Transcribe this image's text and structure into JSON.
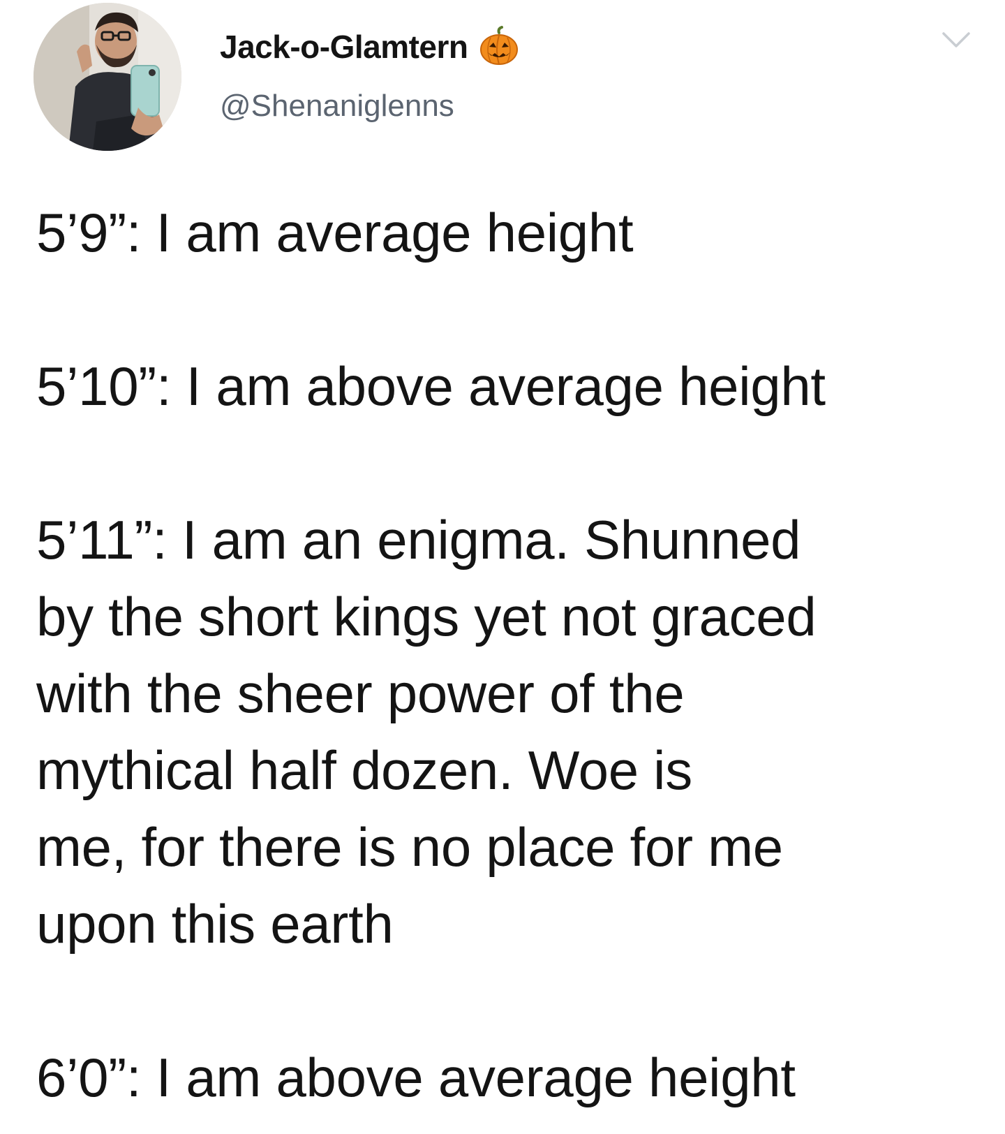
{
  "tweet": {
    "author": {
      "display_name": "Jack-o-Glamtern",
      "handle": "@Shenaniglenns",
      "badge_icon": "jack-o-lantern-icon",
      "avatar": "profile-photo-mirror-selfie"
    },
    "menu_icon": "chevron-down-icon",
    "paragraphs": [
      {
        "lines": [
          "5’9”: I am average height"
        ]
      },
      {
        "lines": [
          "5’10”: I am above average height"
        ]
      },
      {
        "lines": [
          "5’11”: I am an enigma. Shunned",
          "by the short kings yet not graced",
          "with the sheer power of the",
          "mythical half dozen. Woe is",
          "me, for there is no place for me",
          "upon this earth"
        ]
      },
      {
        "lines": [
          "6’0”: I am above average height"
        ]
      }
    ]
  },
  "colors": {
    "background": "#ffffff",
    "text": "#141414",
    "handle": "#5b6470",
    "pumpkin": "#f28c1c",
    "chevron": "#c9cdd2"
  }
}
